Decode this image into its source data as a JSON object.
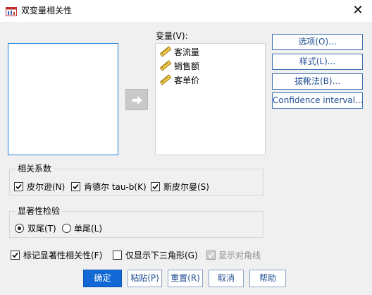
{
  "window": {
    "title": "双变量相关性",
    "close_glyph": "✕"
  },
  "variables": {
    "label": "变量(V):",
    "items": [
      {
        "name": "客流量",
        "icon": "scale-ruler-icon"
      },
      {
        "name": "销售额",
        "icon": "scale-ruler-icon"
      },
      {
        "name": "客单价",
        "icon": "scale-ruler-icon"
      }
    ]
  },
  "move_button": {
    "icon": "arrow-right-icon"
  },
  "side_buttons": {
    "options": "选项(O)...",
    "style": "样式(L)...",
    "bootstrap": "拔靴法(B)...",
    "confidence": "Confidence interval..."
  },
  "correlation": {
    "title": "相关系数",
    "pearson": {
      "label": "皮尔逊(N)",
      "checked": true
    },
    "kendall": {
      "label": "肯德尔 tau-b(K)",
      "checked": true
    },
    "spearman": {
      "label": "斯皮尔曼(S)",
      "checked": true
    }
  },
  "significance": {
    "title": "显著性检验",
    "two_tailed": {
      "label": "双尾(T)",
      "selected": true
    },
    "one_tailed": {
      "label": "单尾(L)",
      "selected": false
    }
  },
  "options_row": {
    "flag_significant": {
      "label": "标记显著性相关性(F)",
      "checked": true
    },
    "lower_triangle": {
      "label": "仅显示下三角形(G)",
      "checked": false
    },
    "show_diagonal": {
      "label": "显示对角线",
      "checked": true,
      "disabled": true
    }
  },
  "bottom_buttons": {
    "ok": "确定",
    "paste": "粘贴(P)",
    "reset": "重置(R)",
    "cancel": "取消",
    "help": "帮助"
  },
  "colors": {
    "accent": "#1268d4",
    "link_text": "#1f4f94",
    "disabled_text": "#8e8e8e"
  }
}
